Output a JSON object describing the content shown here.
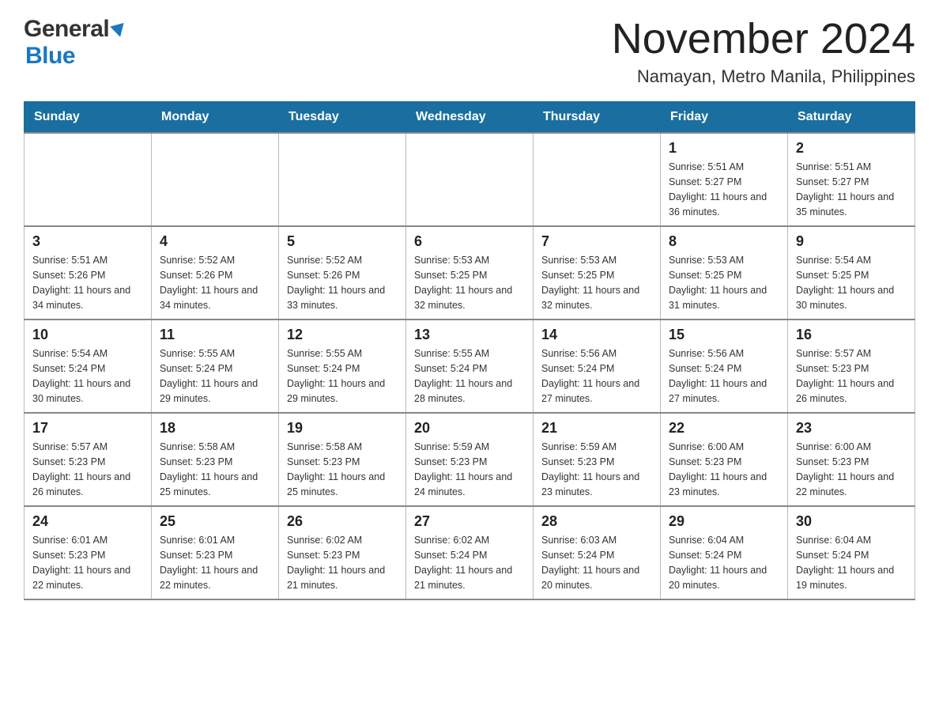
{
  "header": {
    "logo_general": "General",
    "logo_blue": "Blue",
    "main_title": "November 2024",
    "subtitle": "Namayan, Metro Manila, Philippines"
  },
  "calendar": {
    "days_of_week": [
      "Sunday",
      "Monday",
      "Tuesday",
      "Wednesday",
      "Thursday",
      "Friday",
      "Saturday"
    ],
    "weeks": [
      [
        {
          "day": "",
          "info": ""
        },
        {
          "day": "",
          "info": ""
        },
        {
          "day": "",
          "info": ""
        },
        {
          "day": "",
          "info": ""
        },
        {
          "day": "",
          "info": ""
        },
        {
          "day": "1",
          "info": "Sunrise: 5:51 AM\nSunset: 5:27 PM\nDaylight: 11 hours and 36 minutes."
        },
        {
          "day": "2",
          "info": "Sunrise: 5:51 AM\nSunset: 5:27 PM\nDaylight: 11 hours and 35 minutes."
        }
      ],
      [
        {
          "day": "3",
          "info": "Sunrise: 5:51 AM\nSunset: 5:26 PM\nDaylight: 11 hours and 34 minutes."
        },
        {
          "day": "4",
          "info": "Sunrise: 5:52 AM\nSunset: 5:26 PM\nDaylight: 11 hours and 34 minutes."
        },
        {
          "day": "5",
          "info": "Sunrise: 5:52 AM\nSunset: 5:26 PM\nDaylight: 11 hours and 33 minutes."
        },
        {
          "day": "6",
          "info": "Sunrise: 5:53 AM\nSunset: 5:25 PM\nDaylight: 11 hours and 32 minutes."
        },
        {
          "day": "7",
          "info": "Sunrise: 5:53 AM\nSunset: 5:25 PM\nDaylight: 11 hours and 32 minutes."
        },
        {
          "day": "8",
          "info": "Sunrise: 5:53 AM\nSunset: 5:25 PM\nDaylight: 11 hours and 31 minutes."
        },
        {
          "day": "9",
          "info": "Sunrise: 5:54 AM\nSunset: 5:25 PM\nDaylight: 11 hours and 30 minutes."
        }
      ],
      [
        {
          "day": "10",
          "info": "Sunrise: 5:54 AM\nSunset: 5:24 PM\nDaylight: 11 hours and 30 minutes."
        },
        {
          "day": "11",
          "info": "Sunrise: 5:55 AM\nSunset: 5:24 PM\nDaylight: 11 hours and 29 minutes."
        },
        {
          "day": "12",
          "info": "Sunrise: 5:55 AM\nSunset: 5:24 PM\nDaylight: 11 hours and 29 minutes."
        },
        {
          "day": "13",
          "info": "Sunrise: 5:55 AM\nSunset: 5:24 PM\nDaylight: 11 hours and 28 minutes."
        },
        {
          "day": "14",
          "info": "Sunrise: 5:56 AM\nSunset: 5:24 PM\nDaylight: 11 hours and 27 minutes."
        },
        {
          "day": "15",
          "info": "Sunrise: 5:56 AM\nSunset: 5:24 PM\nDaylight: 11 hours and 27 minutes."
        },
        {
          "day": "16",
          "info": "Sunrise: 5:57 AM\nSunset: 5:23 PM\nDaylight: 11 hours and 26 minutes."
        }
      ],
      [
        {
          "day": "17",
          "info": "Sunrise: 5:57 AM\nSunset: 5:23 PM\nDaylight: 11 hours and 26 minutes."
        },
        {
          "day": "18",
          "info": "Sunrise: 5:58 AM\nSunset: 5:23 PM\nDaylight: 11 hours and 25 minutes."
        },
        {
          "day": "19",
          "info": "Sunrise: 5:58 AM\nSunset: 5:23 PM\nDaylight: 11 hours and 25 minutes."
        },
        {
          "day": "20",
          "info": "Sunrise: 5:59 AM\nSunset: 5:23 PM\nDaylight: 11 hours and 24 minutes."
        },
        {
          "day": "21",
          "info": "Sunrise: 5:59 AM\nSunset: 5:23 PM\nDaylight: 11 hours and 23 minutes."
        },
        {
          "day": "22",
          "info": "Sunrise: 6:00 AM\nSunset: 5:23 PM\nDaylight: 11 hours and 23 minutes."
        },
        {
          "day": "23",
          "info": "Sunrise: 6:00 AM\nSunset: 5:23 PM\nDaylight: 11 hours and 22 minutes."
        }
      ],
      [
        {
          "day": "24",
          "info": "Sunrise: 6:01 AM\nSunset: 5:23 PM\nDaylight: 11 hours and 22 minutes."
        },
        {
          "day": "25",
          "info": "Sunrise: 6:01 AM\nSunset: 5:23 PM\nDaylight: 11 hours and 22 minutes."
        },
        {
          "day": "26",
          "info": "Sunrise: 6:02 AM\nSunset: 5:23 PM\nDaylight: 11 hours and 21 minutes."
        },
        {
          "day": "27",
          "info": "Sunrise: 6:02 AM\nSunset: 5:24 PM\nDaylight: 11 hours and 21 minutes."
        },
        {
          "day": "28",
          "info": "Sunrise: 6:03 AM\nSunset: 5:24 PM\nDaylight: 11 hours and 20 minutes."
        },
        {
          "day": "29",
          "info": "Sunrise: 6:04 AM\nSunset: 5:24 PM\nDaylight: 11 hours and 20 minutes."
        },
        {
          "day": "30",
          "info": "Sunrise: 6:04 AM\nSunset: 5:24 PM\nDaylight: 11 hours and 19 minutes."
        }
      ]
    ]
  }
}
